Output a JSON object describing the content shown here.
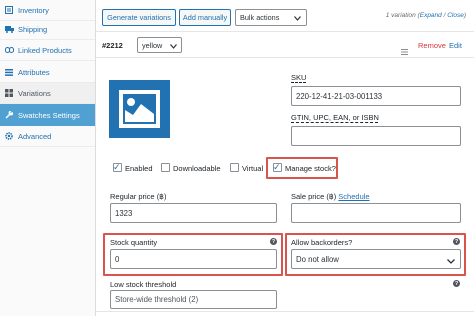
{
  "sidebar": {
    "items": [
      {
        "label": "Inventory",
        "icon": "inventory-icon",
        "active": false
      },
      {
        "label": "Shipping",
        "icon": "truck-icon",
        "active": false
      },
      {
        "label": "Linked Products",
        "icon": "link-icon",
        "active": false
      },
      {
        "label": "Attributes",
        "icon": "list-icon",
        "active": false
      },
      {
        "label": "Variations",
        "icon": "grid-icon",
        "active": false
      },
      {
        "label": "Swatches Settings",
        "icon": "wrench-icon",
        "active": true
      },
      {
        "label": "Advanced",
        "icon": "gear-icon",
        "active": false
      }
    ]
  },
  "toolbar": {
    "generate_label": "Generate variations",
    "add_manually_label": "Add manually",
    "bulk_actions_value": "Bulk actions",
    "variation_count_text": "1 variation (",
    "expand_label": "Expand",
    "separator": " / ",
    "close_label": "Close",
    "close_paren": ")"
  },
  "variation": {
    "id": "#2212",
    "attribute_value": "yellow",
    "remove_label": "Remove",
    "edit_label": "Edit",
    "image_icon": "image-placeholder-icon",
    "sku_label": "SKU",
    "sku_value": "220-12-41-21-03-001133",
    "gtin_label": "GTIN, UPC, EAN, or ISBN",
    "gtin_value": "",
    "checkboxes": {
      "enabled": {
        "label": "Enabled",
        "checked": true
      },
      "downloadable": {
        "label": "Downloadable",
        "checked": false
      },
      "virtual": {
        "label": "Virtual",
        "checked": false
      },
      "manage_stock": {
        "label": "Manage stock?",
        "checked": true
      }
    },
    "regular_price_label": "Regular price (฿)",
    "regular_price_value": "1323",
    "sale_price_label": "Sale price (฿)",
    "schedule_label": "Schedule",
    "sale_price_value": "",
    "stock_quantity_label": "Stock quantity",
    "stock_quantity_value": "0",
    "allow_backorders_label": "Allow backorders?",
    "allow_backorders_value": "Do not allow",
    "low_stock_label": "Low stock threshold",
    "low_stock_placeholder": "Store-wide threshold (2)",
    "help_glyph": "?"
  },
  "colors": {
    "accent": "#2271b1",
    "active_tab": "#50a0d2",
    "highlight": "#d9534f",
    "remove": "#d63638"
  }
}
